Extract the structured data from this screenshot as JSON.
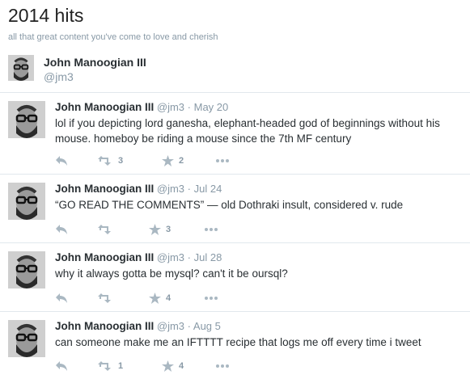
{
  "page": {
    "title": "2014 hits",
    "subtitle": "all that great content you've come to love and cherish"
  },
  "owner": {
    "name": "John Manoogian III",
    "handle": "@jm3"
  },
  "tweets": [
    {
      "name": "John Manoogian III",
      "handle": "@jm3",
      "separator": "·",
      "date": "May 20",
      "text": "lol if you depicting lord ganesha, elephant-headed god of beginnings without his mouse. homeboy be riding a mouse since the 7th MF century",
      "retweets": "3",
      "favorites": "2"
    },
    {
      "name": "John Manoogian III",
      "handle": "@jm3",
      "separator": "·",
      "date": "Jul 24",
      "text": "“GO READ THE COMMENTS” — old Dothraki insult, considered v. rude",
      "retweets": "",
      "favorites": "3"
    },
    {
      "name": "John Manoogian III",
      "handle": "@jm3",
      "separator": "·",
      "date": "Jul 28",
      "text": "why it always gotta be mysql? can't it be oursql?",
      "retweets": "",
      "favorites": "4"
    },
    {
      "name": "John Manoogian III",
      "handle": "@jm3",
      "separator": "·",
      "date": "Aug 5",
      "text": "can someone make me an IFTTTT recipe that logs me off every time i tweet",
      "retweets": "1",
      "favorites": "4"
    }
  ],
  "icons": {
    "reply": "reply-icon",
    "retweet": "retweet-icon",
    "favorite": "star-icon",
    "more": "more-icon"
  }
}
